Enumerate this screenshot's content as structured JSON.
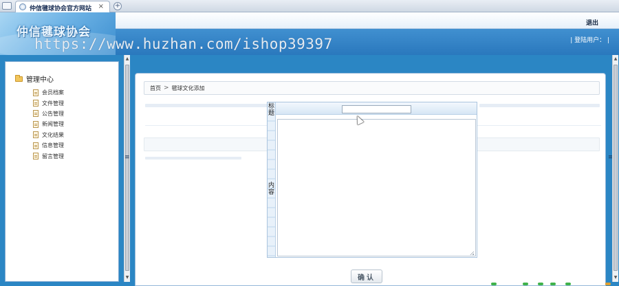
{
  "browser": {
    "tab_title": "仲信毽球协会官方网站",
    "tab_close": "×",
    "new_tab": "+"
  },
  "header": {
    "logo_text": "仲信毽球协会",
    "logout_label": "退出",
    "user_label": "| 登陆用户：  |"
  },
  "watermark": "https://www.huzhan.com/ishop39397",
  "sidebar": {
    "root_label": "管理中心",
    "items": [
      {
        "label": "会员档案"
      },
      {
        "label": "文件管理"
      },
      {
        "label": "公告管理"
      },
      {
        "label": "新闻管理"
      },
      {
        "label": "文化结果"
      },
      {
        "label": "信息管理"
      },
      {
        "label": "留言管理"
      }
    ]
  },
  "breadcrumb": {
    "home": "首页",
    "separator": ">",
    "current": "毽球文化添加"
  },
  "form": {
    "title_label": "标题",
    "content_label": "内容",
    "title_value": "",
    "content_value": ""
  },
  "actions": {
    "confirm_label": "确认"
  },
  "colors": {
    "header_blue": "#2a78bd",
    "page_background": "#2b86c4",
    "border_blue": "#7fa9d1"
  }
}
